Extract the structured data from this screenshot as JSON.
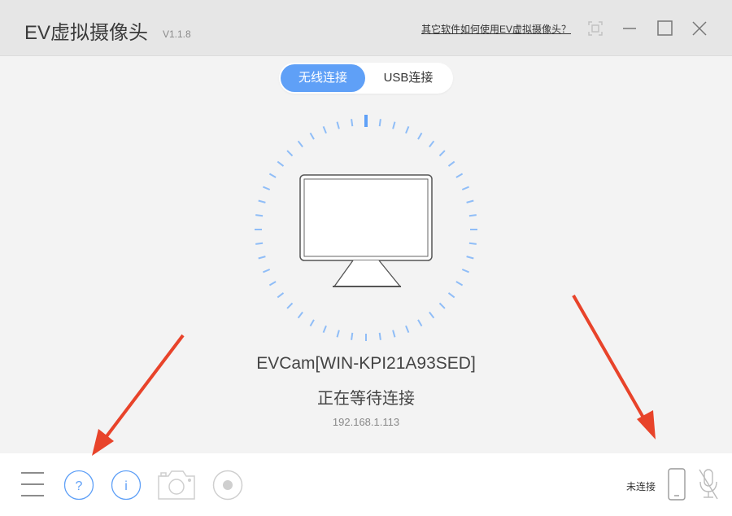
{
  "title_bar": {
    "app_name": "EV虚拟摄像头",
    "version": "V1.1.8",
    "help_link": "其它软件如何使用EV虚拟摄像头？"
  },
  "tabs": [
    {
      "label": "无线连接",
      "active": true
    },
    {
      "label": "USB连接",
      "active": false
    }
  ],
  "device": {
    "name": "EVCam[WIN-KPI21A93SED]",
    "status": "正在等待连接",
    "ip": "192.168.1.113"
  },
  "toolbar": {
    "connection_status": "未连接"
  },
  "colors": {
    "accent": "#5fa0f7",
    "dial_tick": "#8fbdf7",
    "arrow": "#e8432a"
  }
}
